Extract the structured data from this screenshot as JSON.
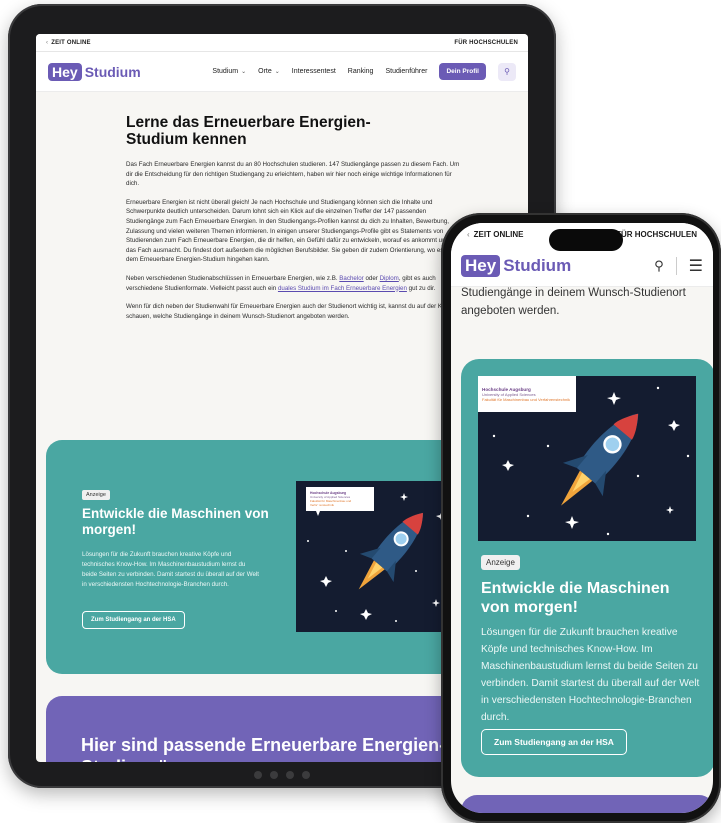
{
  "tablet": {
    "topbar": {
      "left": "ZEIT ONLINE",
      "right": "FÜR HOCHSCHULEN"
    },
    "nav": {
      "logo_hey": "Hey",
      "logo_studium": "Studium",
      "items": [
        "Studium",
        "Orte",
        "Interessentest",
        "Ranking",
        "Studienführer"
      ],
      "profile_button": "Dein Profil",
      "search_icon": "search-icon"
    },
    "article": {
      "title": "Lerne das Erneuerbare Energien-Studium kennen",
      "p1": "Das Fach Erneuerbare Energien kannst du an 80 Hochschulen studieren. 147 Studiengänge passen zu diesem Fach. Um dir die Entscheidung für den richtigen Studiengang zu erleichtern, haben wir hier noch einige wichtige Informationen für dich.",
      "p2": "Erneuerbare Energien ist nicht überall gleich! Je nach Hochschule und Studiengang können sich die Inhalte und Schwerpunkte deutlich unterscheiden. Darum lohnt sich ein Klick auf die einzelnen Treffer der 147 passenden Studiengänge zum Fach Erneuerbare Energien. In den Studiengangs-Profilen kannst du dich zu Inhalten, Bewerbung, Zulassung und vielen weiteren Themen informieren. In einigen unserer Studiengangs-Profile gibt es Statements von Studierenden zum Fach Erneuerbare Energien, die dir helfen, ein Gefühl dafür zu entwickeln, worauf es ankommt und was das Fach ausmacht. Du findest dort außerdem die möglichen Berufsbilder. Sie geben dir zudem Orientierung, wo es nach dem Erneuerbare Energien-Studium hingehen kann.",
      "p3_a": "Neben verschiedenen Studienabschlüssen in Erneuerbare Energien, wie z.B.",
      "p3_link1": "Bachelor",
      "p3_b": "oder",
      "p3_link2": "Diplom",
      "p3_c": ", gibt es auch verschiedene Studienformate. Vielleicht passt auch ein",
      "p3_link3": "duales Studium im Fach Erneuerbare Energien",
      "p3_d": "gut zu dir.",
      "p4": "Wenn für dich neben der Studienwahl für Erneuerbare Energien auch der Studienort wichtig ist, kannst du auf der Karte schauen, welche Studiengänge in deinem Wunsch-Studienort angeboten werden."
    },
    "ad": {
      "badge": "Anzeige",
      "title": "Entwickle die Maschinen von morgen!",
      "text": "Lösungen für die Zukunft brauchen kreative Köpfe und technisches Know-How. Im Maschinenbaustudium lernst du beide Seiten zu verbinden. Damit startest du überall auf der Welt in verschiedensten Hochtechnologie-Branchen durch.",
      "cta": "Zum Studiengang an der HSA",
      "logo_line1": "Hochschule Augsburg",
      "logo_line2": "University of Applied Sciences",
      "logo_line3": "Fakultät für Maschinenbau und Verfahrenstechnik"
    },
    "results_title": "Hier sind passende Erneuerbare Energien-Studiengänge"
  },
  "phone": {
    "topbar": {
      "left": "ZEIT ONLINE",
      "right": "FÜR HOCHSCHULEN"
    },
    "nav": {
      "logo_hey": "Hey",
      "logo_studium": "Studium"
    },
    "text_cut": "Studiengänge in deinem Wunsch-Studienort angeboten werden.",
    "ad": {
      "badge": "Anzeige",
      "title": "Entwickle die Maschinen von morgen!",
      "text": "Lösungen für die Zukunft brauchen kreative Köpfe und technisches Know-How. Im Maschinenbaustudium lernst du beide Seiten zu verbinden. Damit startest du überall auf der Welt in verschiedensten Hochtechnologie-Branchen durch.",
      "cta": "Zum Studiengang an der HSA",
      "logo_line1": "Hochschule Augsburg",
      "logo_line2": "University of Applied Sciences",
      "logo_line3": "Fakultät für Maschinenbau und Verfahrenstechnik"
    }
  },
  "colors": {
    "brand": "#6b5bb5",
    "teal": "#4aa7a2",
    "purple_section": "#7164b7",
    "rocket": "#2f5a86",
    "flame": "#f0a43b"
  }
}
